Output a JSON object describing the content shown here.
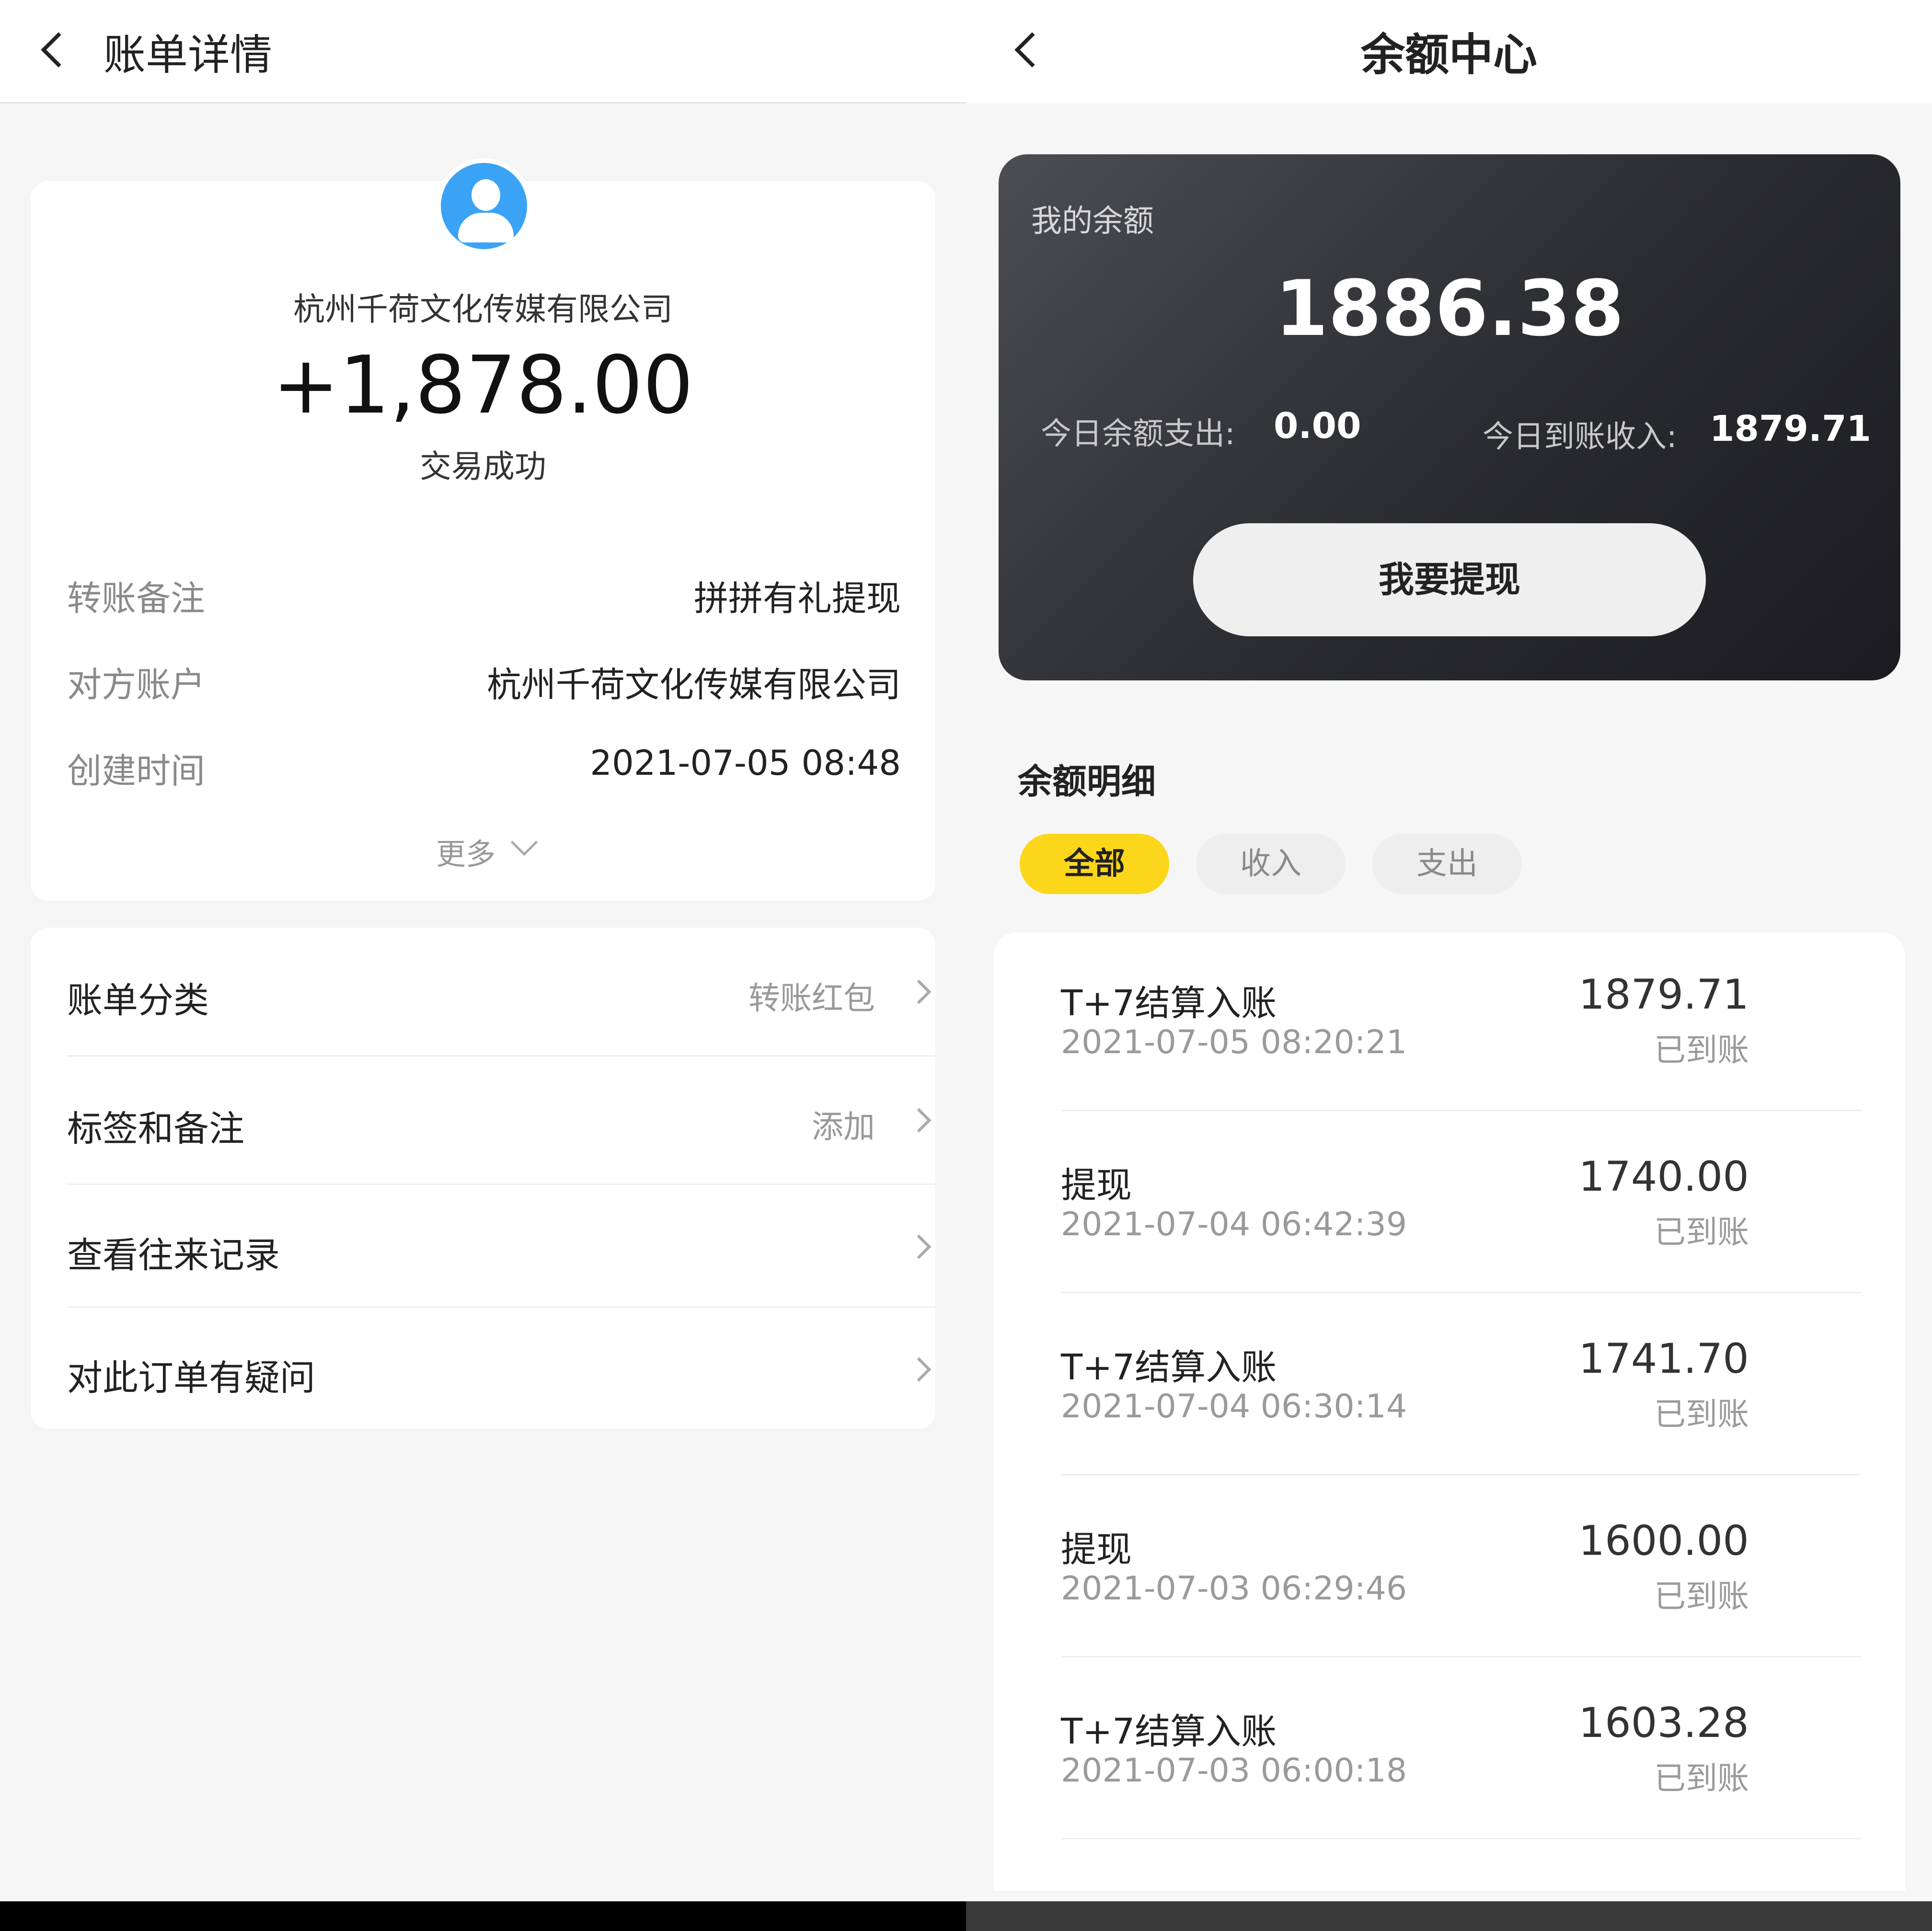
{
  "left": {
    "title": "账单详情",
    "company": "杭州千荷文化传媒有限公司",
    "amount": "+1,878.00",
    "status": "交易成功",
    "details": [
      {
        "label": "转账备注",
        "value": "拼拼有礼提现"
      },
      {
        "label": "对方账户",
        "value": "杭州千荷文化传媒有限公司"
      },
      {
        "label": "创建时间",
        "value": "2021-07-05 08:48"
      }
    ],
    "more": "更多",
    "menu": [
      {
        "label": "账单分类",
        "value": "转账红包"
      },
      {
        "label": "标签和备注",
        "value": "添加"
      },
      {
        "label": "查看往来记录",
        "value": ""
      },
      {
        "label": "对此订单有疑问",
        "value": ""
      }
    ]
  },
  "right": {
    "title": "余额中心",
    "balance_label": "我的余额",
    "balance": "1886.38",
    "today_expense_label": "今日余额支出:",
    "today_expense": "0.00",
    "today_income_label": "今日到账收入:",
    "today_income": "1879.71",
    "withdraw_button": "我要提现",
    "section_title": "余额明细",
    "tabs": [
      "全部",
      "收入",
      "支出"
    ],
    "transactions": [
      {
        "title": "T+7结算入账",
        "time": "2021-07-05 08:20:21",
        "amount": "1879.71",
        "status": "已到账"
      },
      {
        "title": "提现",
        "time": "2021-07-04 06:42:39",
        "amount": "1740.00",
        "status": "已到账"
      },
      {
        "title": "T+7结算入账",
        "time": "2021-07-04 06:30:14",
        "amount": "1741.70",
        "status": "已到账"
      },
      {
        "title": "提现",
        "time": "2021-07-03 06:29:46",
        "amount": "1600.00",
        "status": "已到账"
      },
      {
        "title": "T+7结算入账",
        "time": "2021-07-03 06:00:18",
        "amount": "1603.28",
        "status": "已到账"
      }
    ]
  },
  "colors": {
    "avatar_blue": "#3aa3f6",
    "active_tab_yellow": "#fcd61a",
    "balance_card_dark": "#2a2b2f"
  }
}
